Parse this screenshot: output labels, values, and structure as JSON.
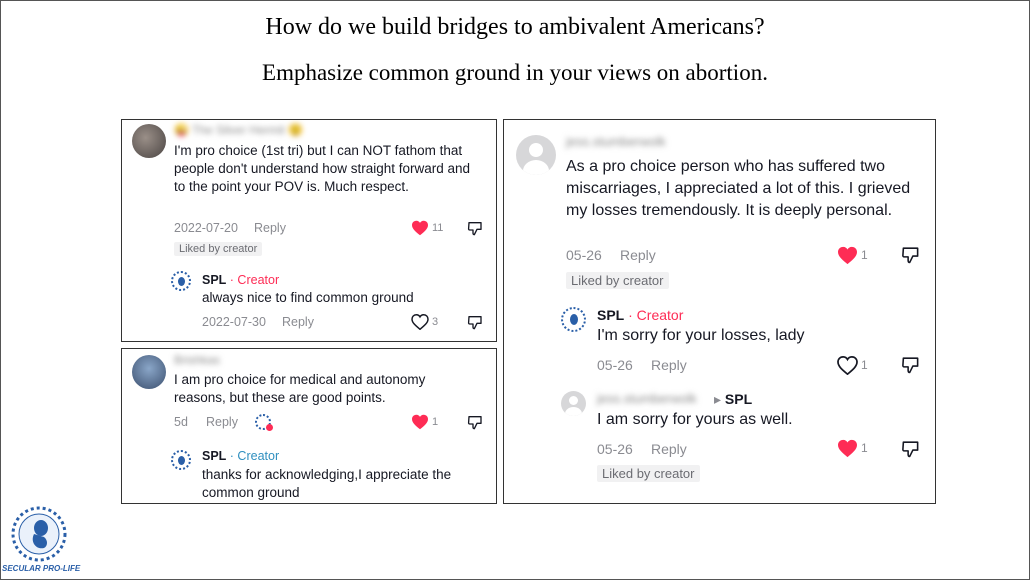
{
  "slide": {
    "title": "How do we build bridges to ambivalent Americans?",
    "subtitle": "Emphasize common ground in your views on abortion.",
    "logo_text": "SECULAR PRO-LIFE"
  },
  "colors": {
    "heart": "#fe2c55",
    "creator": "#fe2c55",
    "creator_alt": "#2f8fbf",
    "meta": "#8a8b91"
  },
  "icons": [
    "heart-icon",
    "heart-outline-icon",
    "dislike-icon",
    "spl-logo-icon",
    "avatar-icon",
    "reply-arrow-icon"
  ],
  "panel1": {
    "comment": {
      "username": "😜 The Silver Hermit 😲",
      "text": "I'm pro choice (1st tri) but I can NOT fathom that people don't understand how straight forward and to the point your POV is. Much respect.",
      "date": "2022-07-20",
      "reply": "Reply",
      "likes": "11",
      "badge": "Liked by creator"
    },
    "reply": {
      "author": "SPL",
      "role": "· Creator",
      "text": "always nice to find common ground",
      "date": "2022-07-30",
      "reply": "Reply",
      "likes": "3"
    }
  },
  "panel2": {
    "comment": {
      "username": "Brishkas",
      "text": "I am pro choice for medical and autonomy reasons, but these are good points.",
      "date": "5d",
      "reply": "Reply",
      "likes": "1"
    },
    "reply": {
      "author": "SPL",
      "role": "· Creator",
      "text": "thanks for acknowledging,I appreciate the common ground"
    }
  },
  "panel3": {
    "comment": {
      "username": "jess.stumberwolk",
      "text": "As a pro choice person who has suffered two miscarriages, I appreciated a lot of this. I grieved my losses tremendously. It is deeply personal.",
      "date": "05-26",
      "reply": "Reply",
      "likes": "1",
      "badge": "Liked by creator"
    },
    "reply1": {
      "author": "SPL",
      "role": "· Creator",
      "text": "I'm sorry for your losses, lady",
      "date": "05-26",
      "reply": "Reply",
      "likes": "1"
    },
    "reply2": {
      "username": "jess.stumberwolk",
      "arrow": "▸",
      "to": "SPL",
      "text": "I am sorry for yours as well.",
      "date": "05-26",
      "reply": "Reply",
      "likes": "1",
      "badge": "Liked by creator"
    }
  }
}
